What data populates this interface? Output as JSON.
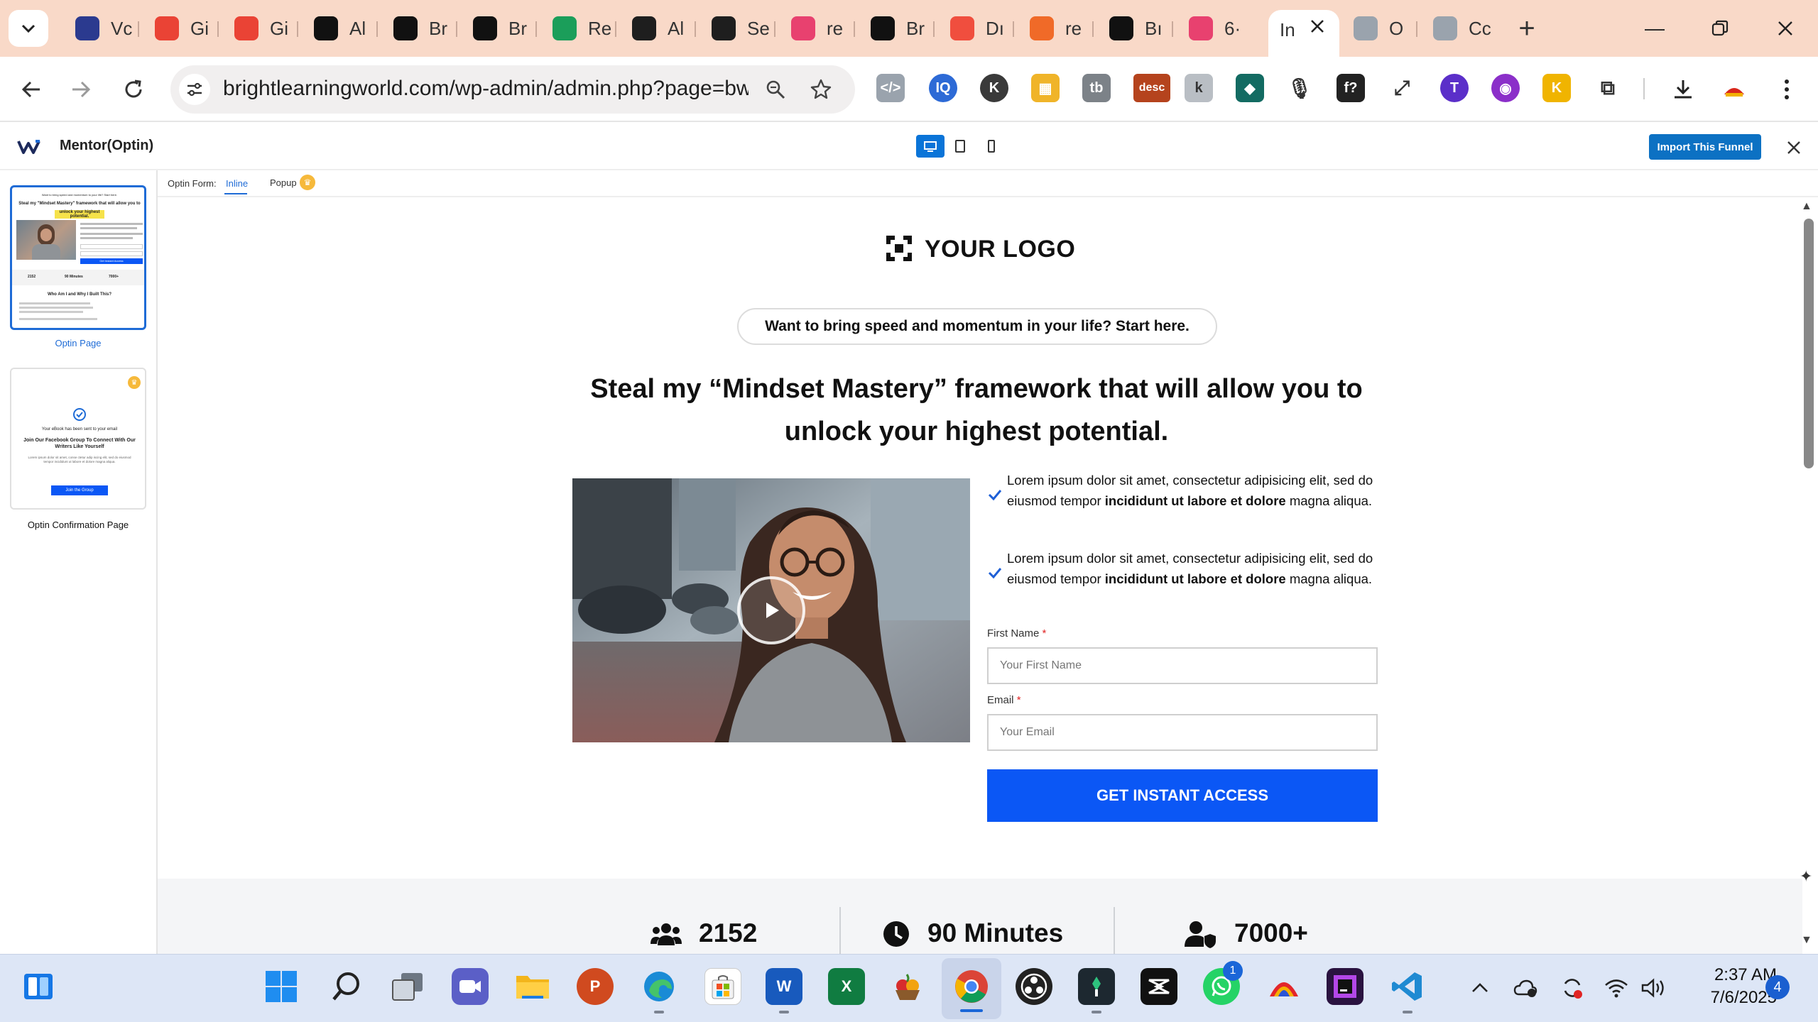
{
  "browser": {
    "tabs": [
      {
        "title": "Vc",
        "icon": "shield-heart-icon",
        "color": "#2b3a8f"
      },
      {
        "title": "Gi",
        "icon": "gmail-icon",
        "color": "#ea4335"
      },
      {
        "title": "Gi",
        "icon": "gmail-icon",
        "color": "#ea4335"
      },
      {
        "title": "Al",
        "icon": "openai-icon",
        "color": "#111111"
      },
      {
        "title": "Br",
        "icon": "github-icon",
        "color": "#111111"
      },
      {
        "title": "Br",
        "icon": "github-icon",
        "color": "#111111"
      },
      {
        "title": "Re",
        "icon": "check-shield-icon",
        "color": "#1b9e5a"
      },
      {
        "title": "Al",
        "icon": "supabase-icon",
        "color": "#1e1e1e"
      },
      {
        "title": "Se",
        "icon": "supabase-icon",
        "color": "#1e1e1e"
      },
      {
        "title": "re",
        "icon": "gradient-blob-icon",
        "color": "#e8416f"
      },
      {
        "title": "Br",
        "icon": "github-icon",
        "color": "#111111"
      },
      {
        "title": "Dı",
        "icon": "red-square-icon",
        "color": "#f04e3e"
      },
      {
        "title": "re",
        "icon": "dots-icon",
        "color": "#f06a28"
      },
      {
        "title": "Bı",
        "icon": "github-icon",
        "color": "#111111"
      },
      {
        "title": "6·",
        "icon": "gradient-blob-icon",
        "color": "#e8416f"
      },
      {
        "title": "In",
        "icon": "active-tab",
        "color": "#ffffff"
      },
      {
        "title": "O",
        "icon": "avatar-icon",
        "color": "#9aa3ad"
      },
      {
        "title": "Cc",
        "icon": "avatar-icon",
        "color": "#9aa3ad"
      }
    ],
    "url": "brightlearningworld.com/wp-admin/admin.php?page=bw...",
    "extensions": [
      {
        "name": "code-ext-icon",
        "label": "</>",
        "color": "#9aa3ad"
      },
      {
        "name": "iq-ext-icon",
        "label": "IQ",
        "color": "#2d6ad6"
      },
      {
        "name": "k-ext-icon",
        "label": "K",
        "color": "#3a3a3a"
      },
      {
        "name": "palette-ext-icon",
        "label": "▦",
        "color": "#f0b429"
      },
      {
        "name": "tb-ext-icon",
        "label": "tb",
        "color": "#7c8288"
      },
      {
        "name": "desc-ext-icon",
        "label": "desc",
        "color": "#b5431d"
      },
      {
        "name": "k2-ext-icon",
        "label": "k",
        "color": "#b9bec4"
      },
      {
        "name": "diamond-ext-icon",
        "label": "◆",
        "color": "#136b62"
      },
      {
        "name": "mic-ext-icon",
        "label": "🎙",
        "color": "#ffffff"
      },
      {
        "name": "fx-ext-icon",
        "label": "f?",
        "color": "#222222"
      },
      {
        "name": "expand-ext-icon",
        "label": "⤢",
        "color": "#ffffff"
      },
      {
        "name": "t-ext-icon",
        "label": "T",
        "color": "#5b2fc9"
      },
      {
        "name": "eye-ext-icon",
        "label": "◉",
        "color": "#8b2fc9"
      },
      {
        "name": "kc-ext-icon",
        "label": "K",
        "color": "#f0b400"
      },
      {
        "name": "puzzle-ext-icon",
        "label": "⧉",
        "color": "#ffffff"
      }
    ]
  },
  "builder": {
    "title": "Mentor(Optin)",
    "import_label": "Import This Funnel",
    "optin_form_label": "Optin Form:",
    "tab_inline": "Inline",
    "tab_popup": "Popup",
    "crown": "♛",
    "pages": [
      {
        "label": "Optin Page"
      },
      {
        "label": "Optin Confirmation Page"
      }
    ],
    "thumb1": {
      "top_text": "Want to bring speed and momentum to your life? Start here.",
      "headline": "Steal my \"Mindset Mastery\" framework that will allow you to",
      "highlight": "unlock your highest potential.",
      "button": "Get Instant Access",
      "stats": [
        "2152",
        "90 Minutes",
        "7000+"
      ],
      "section": "Who Am I and Why I Built This?"
    },
    "thumb2": {
      "line1": "Your eBook has been sent to your email",
      "headline": "Join Our Facebook Group To Connect With Our Writers Like Yourself",
      "body": "Lorem ipsum dolor sit amet, conse ctetur adip iscing elit, sed do eiusmod tempor incididunt ut labore et dolore magna aliqua.",
      "button": "Join the Group"
    }
  },
  "page": {
    "logo_text": "YOUR LOGO",
    "pill_text": "Want to bring speed and momentum in your life? Start here.",
    "headline_line1": "Steal my “Mindset Mastery” framework that will allow you to",
    "headline_line2": "unlock your highest potential.",
    "bullets": [
      {
        "text": "Lorem ipsum dolor sit amet, consectetur adipisicing elit, sed do eiusmod tempor ",
        "bold": "incididunt ut labore et dolore",
        "tail": " magna aliqua."
      },
      {
        "text": "Lorem ipsum dolor sit amet, consectetur adipisicing elit, sed do eiusmod tempor ",
        "bold": "incididunt ut labore et dolore",
        "tail": " magna aliqua."
      }
    ],
    "form": {
      "first_name_label": "First Name",
      "first_name_placeholder": "Your First Name",
      "email_label": "Email",
      "email_placeholder": "Your Email",
      "required_mark": "*",
      "cta": "GET INSTANT ACCESS"
    },
    "stats": [
      {
        "icon": "users-icon",
        "value": "2152"
      },
      {
        "icon": "clock-icon",
        "value": "90 Minutes"
      },
      {
        "icon": "user-shield-icon",
        "value": "7000+"
      }
    ]
  },
  "taskbar": {
    "time": "2:37 AM",
    "date": "7/6/2025",
    "notifications": "4",
    "whatsapp_badge": "1"
  },
  "colors": {
    "accent": "#0b57f5",
    "builder_blue": "#0c71c3",
    "tab_strip": "#f9d9c8"
  }
}
